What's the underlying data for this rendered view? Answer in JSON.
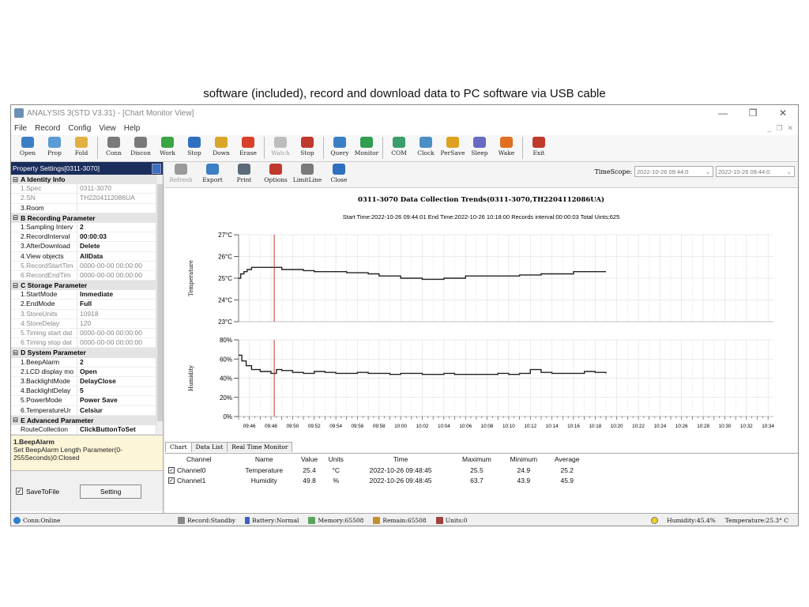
{
  "caption": "software (included), record and download data to PC software via USB cable",
  "window": {
    "title": "ANALYSIS 3(STD V3.31) - [Chart Monitor View]",
    "controls": [
      "—",
      "❐",
      "✕"
    ]
  },
  "menu": [
    "File",
    "Record",
    "Config",
    "View",
    "Help"
  ],
  "mdi_controls": [
    "_",
    "❐",
    "✕"
  ],
  "toolbar": [
    {
      "label": "Open",
      "icon": "folder-open-icon",
      "color": "#3b7fc4",
      "enabled": true
    },
    {
      "label": "Prop",
      "icon": "properties-icon",
      "color": "#5a9bd5",
      "enabled": true
    },
    {
      "label": "Fold",
      "icon": "folder-icon",
      "color": "#e0b040",
      "enabled": true
    },
    {
      "label": "Conn",
      "icon": "connect-icon",
      "color": "#7a7a7a",
      "enabled": true,
      "sep_before": true
    },
    {
      "label": "Discon",
      "icon": "disconnect-icon",
      "color": "#7a7a7a",
      "enabled": true
    },
    {
      "label": "Work",
      "icon": "play-icon",
      "color": "#3aa545",
      "enabled": true
    },
    {
      "label": "Stop",
      "icon": "pause-icon",
      "color": "#2f6fbf",
      "enabled": true
    },
    {
      "label": "Down",
      "icon": "download-icon",
      "color": "#d9a62a",
      "enabled": true
    },
    {
      "label": "Erase",
      "icon": "erase-icon",
      "color": "#d9412a",
      "enabled": true
    },
    {
      "label": "Watch",
      "icon": "watch-icon",
      "color": "#bdbdbd",
      "enabled": false,
      "sep_before": true
    },
    {
      "label": "Stop",
      "icon": "stop-watch-icon",
      "color": "#c0392b",
      "enabled": true
    },
    {
      "label": "Query",
      "icon": "query-icon",
      "color": "#3b7fc4",
      "enabled": true,
      "sep_before": true
    },
    {
      "label": "Monitor",
      "icon": "monitor-icon",
      "color": "#2f9e4f",
      "enabled": true
    },
    {
      "label": "COM",
      "icon": "com-gear-icon",
      "color": "#3a9e6a",
      "enabled": true,
      "sep_before": true
    },
    {
      "label": "Clock",
      "icon": "clock-icon",
      "color": "#4a90c4",
      "enabled": true
    },
    {
      "label": "PerSave",
      "icon": "lock-icon",
      "color": "#e0a020",
      "enabled": true
    },
    {
      "label": "Sleep",
      "icon": "sleep-icon",
      "color": "#6a6ac4",
      "enabled": true
    },
    {
      "label": "Wake",
      "icon": "wake-sun-icon",
      "color": "#e07020",
      "enabled": true
    },
    {
      "label": "Exit",
      "icon": "exit-icon",
      "color": "#c0392b",
      "enabled": true,
      "sep_before": true
    }
  ],
  "left_panel": {
    "header": "Property Settings[0311-3070]",
    "categories": [
      {
        "title": "A Identity Info",
        "rows": [
          {
            "k": "1.Spec",
            "v": "0311-3070",
            "ro": true
          },
          {
            "k": "2.SN",
            "v": "TH2204112086UA",
            "ro": true
          },
          {
            "k": "3.Room",
            "v": "",
            "ro": false
          }
        ]
      },
      {
        "title": "B Recording Parameter",
        "rows": [
          {
            "k": "1.Sampling Interv",
            "v": "2",
            "ro": false
          },
          {
            "k": "2.RecordInterval",
            "v": "00:00:03",
            "ro": false
          },
          {
            "k": "3.AfterDownload",
            "v": "Delete",
            "ro": false
          },
          {
            "k": "4.View objects",
            "v": "AllData",
            "ro": false
          },
          {
            "k": "5.RecordStartTim",
            "v": "0000-00-00 00:00:00",
            "ro": true
          },
          {
            "k": "6.RecordEndTim",
            "v": "0000-00-00 00:00:00",
            "ro": true
          }
        ]
      },
      {
        "title": "C Storage Parameter",
        "rows": [
          {
            "k": "1.StartMode",
            "v": "Immediate",
            "ro": false
          },
          {
            "k": "2.EndMode",
            "v": "Full",
            "ro": false
          },
          {
            "k": "3.StoreUnits",
            "v": "10918",
            "ro": true
          },
          {
            "k": "4.StoreDelay",
            "v": "120",
            "ro": true
          },
          {
            "k": "5.Timing start dat",
            "v": "0000-00-00 00:00:00",
            "ro": true
          },
          {
            "k": "6.Timing stop dat",
            "v": "0000-00-00 00:00:00",
            "ro": true
          }
        ]
      },
      {
        "title": "D System Parameter",
        "rows": [
          {
            "k": "1.BeepAlarm",
            "v": "2",
            "ro": false
          },
          {
            "k": "2.LCD display mo",
            "v": "Open",
            "ro": false
          },
          {
            "k": "3.BacklightMode",
            "v": "DelayClose",
            "ro": false
          },
          {
            "k": "4.BacklightDelay",
            "v": "5",
            "ro": false
          },
          {
            "k": "5.PowerMode",
            "v": "Power Save",
            "ro": false
          },
          {
            "k": "6.TemperatureUr",
            "v": "Celsiur",
            "ro": false
          }
        ]
      },
      {
        "title": "E Advanced Parameter",
        "rows": [
          {
            "k": "RouteCollection",
            "v": "ClickButtonToSet",
            "ro": false
          }
        ]
      }
    ],
    "desc_title": "1.BeepAlarm",
    "desc_text": "Set BeepAlarm Length Parameter(0-255Seconds)0:Closed",
    "save_to_file": "SaveToFile",
    "setting_button": "Setting"
  },
  "right_toolbar": [
    {
      "label": "Refresh",
      "icon": "refresh-icon",
      "color": "#9a9a9a",
      "enabled": false
    },
    {
      "label": "Export",
      "icon": "export-icon",
      "color": "#3b7fc4",
      "enabled": true
    },
    {
      "label": "Print",
      "icon": "print-icon",
      "color": "#5a6a7a",
      "enabled": true
    },
    {
      "label": "Options",
      "icon": "options-icon",
      "color": "#c0392b",
      "enabled": true
    },
    {
      "label": "LimitLine",
      "icon": "limitline-icon",
      "color": "#7a7a7a",
      "enabled": true
    },
    {
      "label": "Close",
      "icon": "close-power-icon",
      "color": "#2f6fbf",
      "enabled": true
    }
  ],
  "timescope": {
    "label": "TimeScope:",
    "start": "2022-10-26 09:44:0",
    "end": "2022-10-26 09:44:0"
  },
  "chart_data": {
    "type": "line",
    "title": "0311-3070 Data Collection Trends(0311-3070,TH2204112086UA)",
    "subtitle": "Start Time:2022-10-26 09:44:01   End Time:2022-10-26 10:18:00   Records interval:00:00:03   Total Uints:625",
    "x_unit": "minutes after 09:45",
    "x_ticks": [
      "09:46",
      "09:48",
      "09:50",
      "09:52",
      "09:54",
      "09:56",
      "09:58",
      "10:00",
      "10:02",
      "10:04",
      "10:06",
      "10:08",
      "10:10",
      "10:12",
      "10:14",
      "10:16",
      "10:18",
      "10:20",
      "10:22",
      "10:24",
      "10:26",
      "10:28",
      "10:30",
      "10:32",
      "10:34"
    ],
    "marker_x": 3.3,
    "panels": [
      {
        "ylabel": "Temperature",
        "ylim": [
          23,
          27
        ],
        "yticks": [
          "23°C",
          "24°C",
          "25°C",
          "26°C",
          "27°C"
        ],
        "series": {
          "x": [
            0,
            0.2,
            0.5,
            0.8,
            1.2,
            1.8,
            3,
            4,
            5,
            6,
            7,
            8,
            9,
            10,
            11,
            12,
            13,
            14,
            15,
            16,
            17,
            18,
            19,
            20,
            21,
            22,
            23,
            24,
            25,
            26,
            27,
            28,
            29,
            30,
            31,
            32,
            33,
            34
          ],
          "y": [
            25.0,
            25.2,
            25.3,
            25.4,
            25.5,
            25.5,
            25.5,
            25.4,
            25.4,
            25.35,
            25.3,
            25.3,
            25.3,
            25.25,
            25.25,
            25.2,
            25.1,
            25.1,
            25.0,
            25.0,
            24.95,
            24.95,
            25.0,
            25.0,
            25.1,
            25.1,
            25.1,
            25.1,
            25.1,
            25.15,
            25.15,
            25.2,
            25.2,
            25.2,
            25.3,
            25.3,
            25.3,
            25.3
          ]
        }
      },
      {
        "ylabel": "Humidity",
        "ylim": [
          0,
          80
        ],
        "yticks": [
          "0%",
          "20%",
          "40%",
          "60%",
          "80%"
        ],
        "series": {
          "x": [
            0,
            0.3,
            0.7,
            1.2,
            2,
            3,
            3.5,
            4,
            5,
            6,
            7,
            8,
            9,
            10,
            11,
            12,
            13,
            14,
            15,
            16,
            17,
            18,
            19,
            20,
            21,
            22,
            23,
            24,
            25,
            26,
            27,
            28,
            29,
            30,
            31,
            32,
            33,
            34
          ],
          "y": [
            64,
            58,
            53,
            49,
            47,
            45,
            49,
            48,
            46,
            45,
            47,
            46,
            45,
            45,
            46,
            45,
            45,
            44,
            45,
            45,
            44,
            44,
            45,
            44,
            44,
            44,
            44,
            45,
            44,
            45,
            49,
            46,
            45,
            45,
            45,
            47,
            46,
            45
          ]
        }
      }
    ]
  },
  "tabs": [
    "Chart",
    "Data List",
    "Real Time Monitor"
  ],
  "table": {
    "headers": [
      "Channel",
      "Name",
      "Value",
      "Units",
      "Time",
      "Maximum",
      "Minimum",
      "Average"
    ],
    "rows": [
      [
        "Channel0",
        "Temperature",
        "25.4",
        "°C",
        "2022-10-26 09:48:45",
        "25.5",
        "24.9",
        "25.2"
      ],
      [
        "Channel1",
        "Humidity",
        "49.8",
        "%",
        "2022-10-26 09:48:45",
        "63.7",
        "43.9",
        "45.9"
      ]
    ]
  },
  "status": {
    "conn": "Conn:Online",
    "record": "Record:Standby",
    "battery": "Battery:Normal",
    "memory": "Memory:65508",
    "remain": "Remain:65508",
    "units": "Units:0",
    "humidity": "Humidity:45.4%",
    "temperature": "Temperature:25.3° C"
  },
  "colors": {
    "series": "#222222",
    "marker": "#c0392b",
    "grid": "#d8d8d8"
  }
}
